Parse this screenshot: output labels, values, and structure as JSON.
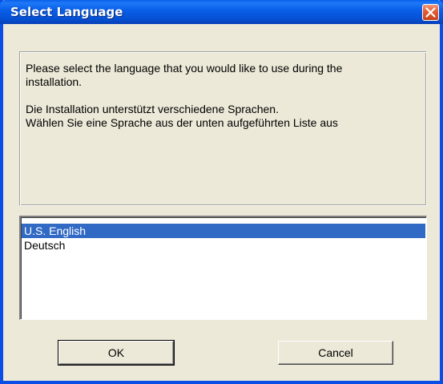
{
  "window": {
    "title": "Select Language"
  },
  "message": {
    "line1": "Please select the language that you would like to use during the",
    "line2": "installation.",
    "line3": "Die Installation unterstützt verschiedene Sprachen.",
    "line4": "Wählen Sie eine Sprache aus der unten aufgeführten Liste aus"
  },
  "languages": {
    "items": [
      {
        "label": "U.S. English",
        "selected": true
      },
      {
        "label": "Deutsch",
        "selected": false
      }
    ]
  },
  "buttons": {
    "ok_label": "OK",
    "cancel_label": "Cancel"
  },
  "colors": {
    "titlebar": "#0a5fe8",
    "selection": "#316ac5",
    "dialog_bg": "#ece9d8",
    "close_button": "#e25a2f"
  },
  "icons": {
    "close": "close-icon"
  }
}
